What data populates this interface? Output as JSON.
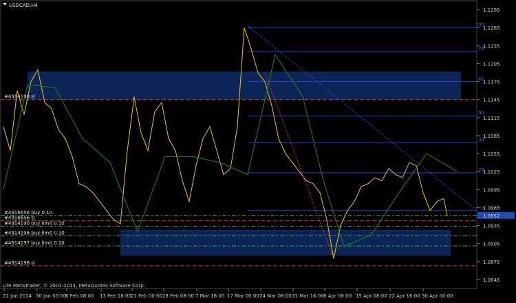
{
  "window": {
    "menu_icon": "triangle-down-icon",
    "title": "USDCAD,H4"
  },
  "axes": {
    "price_labels": [
      "1.1295",
      "1.1265",
      "1.1235",
      "1.1205",
      "1.1175",
      "1.1145",
      "1.1115",
      "1.1085",
      "1.1055",
      "1.1025",
      "1.0995",
      "1.0965",
      "1.0935",
      "1.0905",
      "1.0875",
      "1.0845"
    ],
    "price_values": [
      1.1295,
      1.1265,
      1.1235,
      1.1205,
      1.1175,
      1.1145,
      1.1115,
      1.1085,
      1.1055,
      1.1025,
      1.0995,
      1.0965,
      1.0935,
      1.0905,
      1.0875,
      1.0845
    ],
    "current_price_label": "1.0952",
    "current_price": 1.0952,
    "time_labels": [
      "22 Jan 2014",
      "30 Jan 00:00",
      "6 Feb 08:00",
      "13 Feb 16:00",
      "21 Feb 00:00",
      "28 Feb 08:00",
      "7 Mar 16:00",
      "17 Mar 00:00",
      "24 Mar 08:00",
      "31 Mar 16:00",
      "8 Apr 00:00",
      "15 Apr 08:00",
      "22 Apr 16:00",
      "30 Apr 00:00"
    ],
    "ylim": [
      1.083,
      1.131
    ]
  },
  "zones": [
    {
      "name": "supply-zone",
      "from": 1.1192,
      "to": 1.1145,
      "color": "#0f2a66"
    },
    {
      "name": "demand-zone",
      "from": 1.0928,
      "to": 1.0885,
      "color": "#0f2a66"
    }
  ],
  "orders": {
    "top_sl": {
      "label": "#4914198 sl",
      "price": 1.1145
    },
    "buy_0": {
      "label": "#4916656 buy 0.10",
      "price": 1.0952
    },
    "sl_1": {
      "label": "#4916656 sl",
      "price": 1.0943
    },
    "buy_limit_1": {
      "label": "#4914190 buy limit 0.10",
      "price": 1.0934
    },
    "buy_limit_2": {
      "label": "#4914196 buy limit 0.10",
      "price": 1.0918
    },
    "buy_limit_3": {
      "label": "#4914197 buy limit 0.10",
      "price": 1.0901
    },
    "bottom_sl": {
      "label": "#4914198 sl",
      "price": 1.0868
    }
  },
  "fib_labels": [
    "100",
    "76",
    "61",
    "50",
    "38",
    "23",
    "0"
  ],
  "fib_values": [
    1.1265,
    1.1225,
    1.1175,
    1.1118,
    1.1073,
    1.1023,
    1.096
  ],
  "colors": {
    "price_line": "#f0c419",
    "ma_line": "#1a8a1a",
    "sl_line": "#d23a3a",
    "order_line": "#2fae6a",
    "fib_line": "#2742c9",
    "current_price_box": "#1f4db5"
  },
  "footer": {
    "copyright": "Life MetaTrader, © 2001-2014, MetaQuotes Software Corp."
  }
}
